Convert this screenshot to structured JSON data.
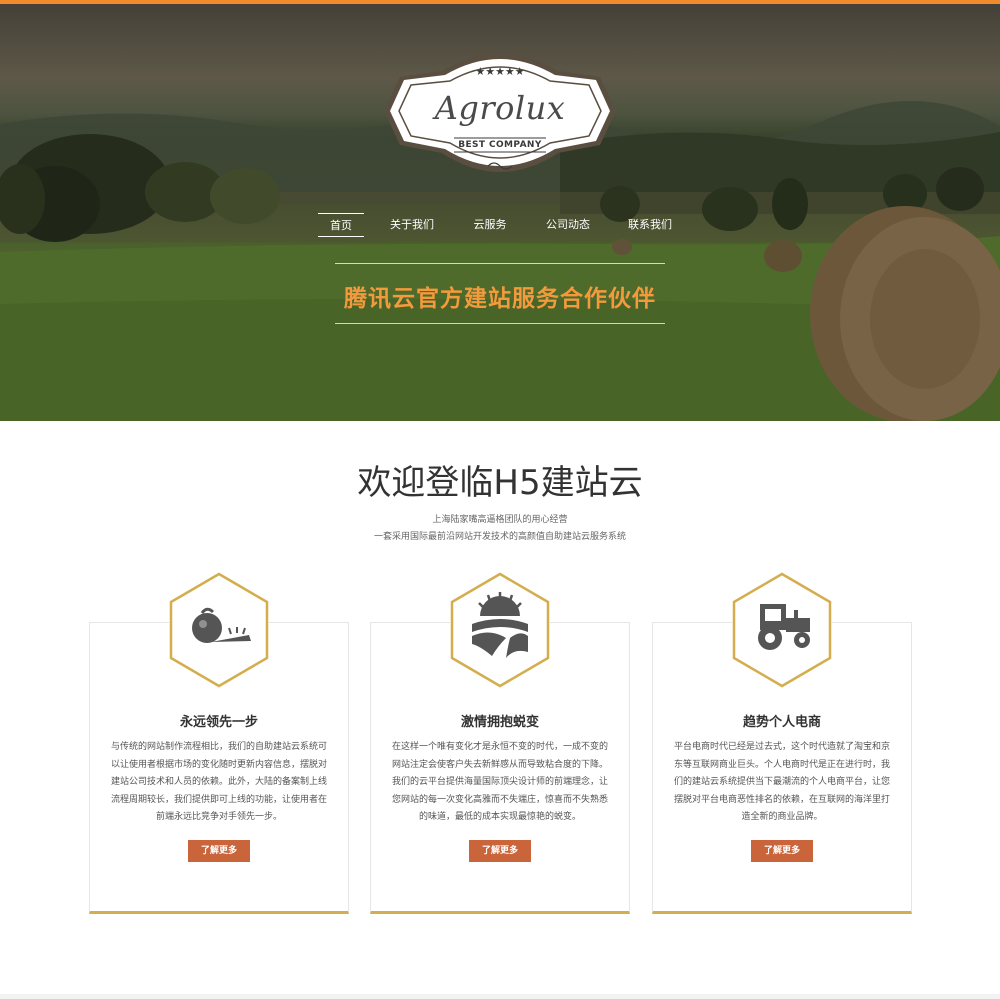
{
  "brand": {
    "logo_text": "Agrolux",
    "logo_sub": "BEST COMPANY",
    "accent": "#f08a2a",
    "gold": "#d4ae4e",
    "button_color": "#c9643b"
  },
  "nav": {
    "items": [
      {
        "label": "首页",
        "active": true
      },
      {
        "label": "关于我们",
        "active": false
      },
      {
        "label": "云服务",
        "active": false
      },
      {
        "label": "公司动态",
        "active": false
      },
      {
        "label": "联系我们",
        "active": false
      }
    ]
  },
  "hero": {
    "slogan": "腾讯云官方建站服务合作伙伴"
  },
  "intro": {
    "title": "欢迎登临H5建站云",
    "subtitle_1": "上海陆家嘴高逼格团队的用心经营",
    "subtitle_2": "一套采用国际最前沿网站开发技术的高颜值自助建站云服务系统"
  },
  "cards": [
    {
      "icon": "vegetables-icon",
      "title": "永远领先一步",
      "text": "与传统的网站制作流程相比，我们的自助建站云系统可以让使用者根据市场的变化随时更新内容信息，摆脱对建站公司技术和人员的依赖。此外，大陆的备案制上线流程周期较长，我们提供即可上线的功能，让使用者在前端永远比竞争对手领先一步。",
      "button": "了解更多"
    },
    {
      "icon": "farm-field-icon",
      "title": "激情拥抱蜕变",
      "text": "在这样一个唯有变化才是永恒不变的时代，一成不变的网站注定会使客户失去新鲜感从而导致粘合度的下降。我们的云平台提供海量国际顶尖设计师的前端理念，让您网站的每一次变化高雅而不失端庄，惊喜而不失熟悉的味道，最低的成本实现最惊艳的蜕变。",
      "button": "了解更多"
    },
    {
      "icon": "tractor-icon",
      "title": "趋势个人电商",
      "text": "平台电商时代已经是过去式，这个时代造就了淘宝和京东等互联网商业巨头。个人电商时代是正在进行时，我们的建站云系统提供当下最潮流的个人电商平台，让您摆脱对平台电商恶性排名的依赖，在互联网的海洋里打造全新的商业品牌。",
      "button": "了解更多"
    }
  ]
}
